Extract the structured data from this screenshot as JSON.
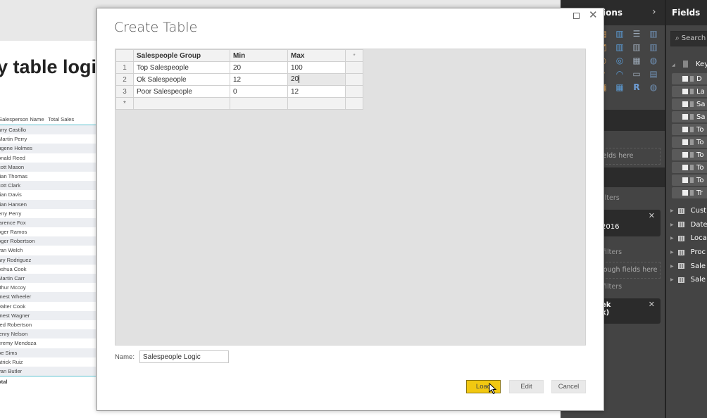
{
  "report": {
    "title_fragment": "y table logic",
    "table": {
      "headers": [
        "Salesperson Name",
        "Total Sales"
      ],
      "rows": [
        "arry Castillo",
        "Martin Perry",
        "ugene Holmes",
        "onald Reed",
        "cott Mason",
        "rian Thomas",
        "cott Clark",
        "rian Davis",
        "rian Hansen",
        "erry Perry",
        "larence Fox",
        "oger Ramos",
        "oger Robertson",
        "yan Welch",
        "ary Rodriguez",
        "oshua Cook",
        "Martin Carr",
        "rthur Mccoy",
        "rnest Wheeler",
        "Valter Cook",
        "rnest Wagner",
        "red Robertson",
        "lenry Nelson",
        "eremy Mendoza",
        "oe Sims",
        "atrick Ruiz",
        "yan Butler"
      ],
      "total_label": "otal"
    }
  },
  "visualizations": {
    "title": "ions",
    "chevron": "›",
    "labels": {
      "fields_here": "ields here",
      "filters1": "ilters",
      "filter_card1": "2016",
      "filters2": "filters",
      "drill_through": "rough fields here",
      "filters3": "filters",
      "filter_card2_line1": "ek",
      "filter_card2_line2": "k)"
    },
    "icons": [
      "stacked-bar-icon",
      "clustered-column-icon",
      "stacked-bar-100-icon",
      "column-100-icon",
      "area-icon",
      "line-column-icon",
      "ribbon-icon",
      "waterfall-icon",
      "pie-icon",
      "donut-icon",
      "treemap-icon",
      "globe-map-icon",
      "funnel-icon",
      "gauge-icon",
      "card-icon",
      "multirow-card-icon",
      "table-icon",
      "matrix-icon",
      "r-visual-icon",
      "globe-icon"
    ]
  },
  "fields": {
    "title": "Fields",
    "search_placeholder": "Search",
    "group": "Key",
    "measures": [
      "D",
      "La",
      "Sa",
      "Sa",
      "To",
      "To",
      "To",
      "To",
      "To",
      "Tr"
    ],
    "tables": [
      "Cust",
      "Date",
      "Loca",
      "Proc",
      "Sale",
      "Sale"
    ]
  },
  "dialog": {
    "title": "Create Table",
    "columns": [
      "Salespeople Group",
      "Min",
      "Max"
    ],
    "add_column_symbol": "*",
    "new_row_symbol": "*",
    "rows": [
      {
        "num": "1",
        "group": "Top Salespeople",
        "min": "20",
        "max": "100"
      },
      {
        "num": "2",
        "group": "Ok Salespeople",
        "min": "12",
        "max": "20"
      },
      {
        "num": "3",
        "group": "Poor Salespeople",
        "min": "0",
        "max": "12"
      }
    ],
    "name_label": "Name:",
    "name_value": "Salespeople Logic",
    "buttons": {
      "load": "Load",
      "edit": "Edit",
      "cancel": "Cancel"
    },
    "close_symbol": "✕"
  },
  "colors": {
    "accent_yellow": "#f2c811",
    "table_accent": "#59c1cf",
    "panel_dark": "#444444"
  }
}
